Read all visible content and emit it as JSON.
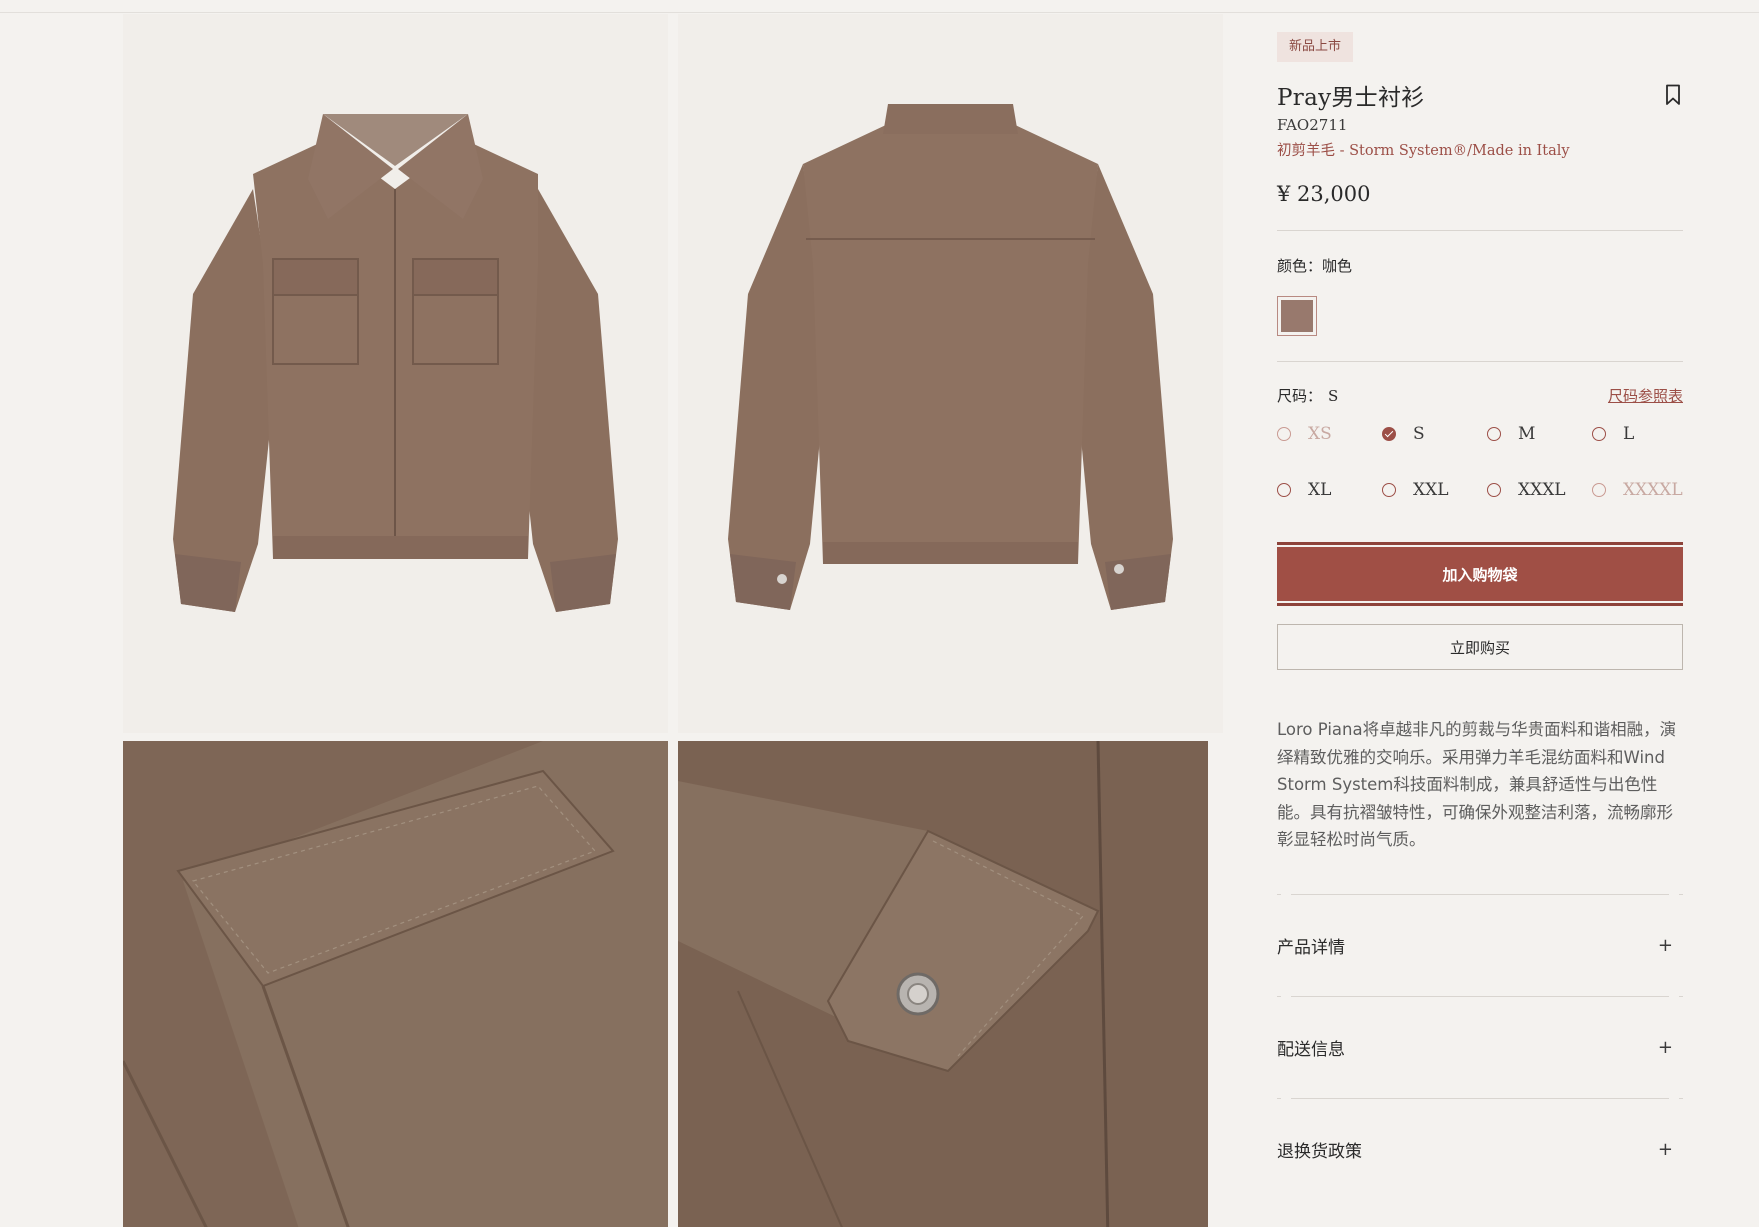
{
  "product": {
    "badge": "新品上市",
    "title": "Pray男士衬衫",
    "sku": "FAO2711",
    "material": "初剪羊毛 - Storm System®/Made in Italy",
    "price": "¥ 23,000"
  },
  "color": {
    "label": "颜色：咖色",
    "swatch_hex": "#98796d"
  },
  "size": {
    "label": "尺码：",
    "selected": "S",
    "chart_link": "尺码参照表",
    "options": [
      {
        "label": "XS",
        "state": "disabled"
      },
      {
        "label": "S",
        "state": "checked"
      },
      {
        "label": "M",
        "state": "available"
      },
      {
        "label": "L",
        "state": "available"
      },
      {
        "label": "XL",
        "state": "available"
      },
      {
        "label": "XXL",
        "state": "available"
      },
      {
        "label": "XXXL",
        "state": "available"
      },
      {
        "label": "XXXXL",
        "state": "disabled"
      }
    ]
  },
  "actions": {
    "add_to_bag": "加入购物袋",
    "buy_now": "立即购买"
  },
  "description": "Loro Piana将卓越非凡的剪裁与华贵面料和谐相融，演绎精致优雅的交响乐。采用弹力羊毛混纺面料和Wind Storm System科技面料制成，兼具舒适性与出色性能。具有抗褶皱特性，可确保外观整洁利落，流畅廓形彰显轻松时尚气质。",
  "accordion": {
    "items": [
      "产品详情",
      "配送信息",
      "退换货政策"
    ],
    "expand_icon": "+"
  },
  "colors": {
    "accent": "#a04f45",
    "fabric": "#8c705f",
    "background": "#f4f2ef"
  }
}
